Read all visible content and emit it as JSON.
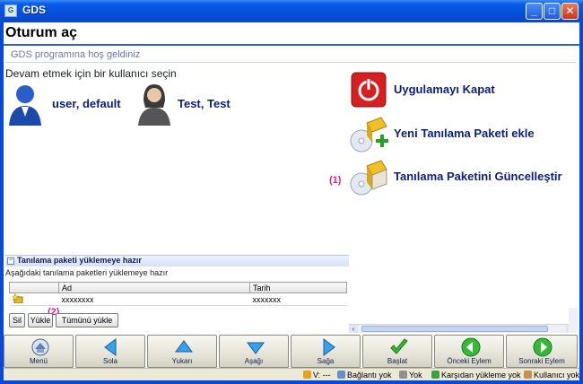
{
  "window": {
    "title": "GDS",
    "icon": "app-icon",
    "minimize": "_",
    "maximize": "□",
    "close": "✕"
  },
  "page": {
    "heading": "Oturum aç",
    "welcome": "GDS programına hoş geldiniz",
    "prompt": "Devam etmek için bir kullanıcı seçin"
  },
  "users": [
    {
      "name": "user, default",
      "icon": "male-user-icon"
    },
    {
      "name": "Test, Test",
      "icon": "female-user-icon"
    }
  ],
  "actions": [
    {
      "label": "Uygulamayı Kapat",
      "icon": "power-icon"
    },
    {
      "label": "Yeni Tanılama Paketi ekle",
      "icon": "add-package-icon"
    },
    {
      "label": "Tanılama Paketini Güncelleştir",
      "icon": "update-package-icon",
      "marker": "(1)"
    }
  ],
  "panel": {
    "header": "Tanılama paketi yüklemeye hazır",
    "toggle": "−",
    "subtitle": "Aşağıdaki tanılama paketleri yüklemeye hazır",
    "columns": [
      "",
      "Ad",
      "Tarih"
    ],
    "rows": [
      {
        "name": "xxxxxxxx",
        "date": "xxxxxxx"
      }
    ],
    "marker": "(2)",
    "buttons": {
      "delete": "Sil",
      "load": "Yükle",
      "load_all": "Tümünü yükle"
    }
  },
  "scroll": {
    "left": "‹",
    "right": "›"
  },
  "toolbar": [
    "Menü",
    "Sola",
    "Yukarı",
    "Aşağı",
    "Sağa",
    "Başlat",
    "Önceki Eylem",
    "Sonraki Eylem"
  ],
  "status": {
    "version": "V: ---",
    "connection": "Bağlantı yok",
    "storage": "Yok",
    "upload": "Karşıdan yükleme yok",
    "user": "Kullanıcı yok"
  },
  "colors": {
    "accent": "#0a48d8",
    "link": "#0c1e7a",
    "marker": "#e0208a",
    "power": "#d42020"
  }
}
